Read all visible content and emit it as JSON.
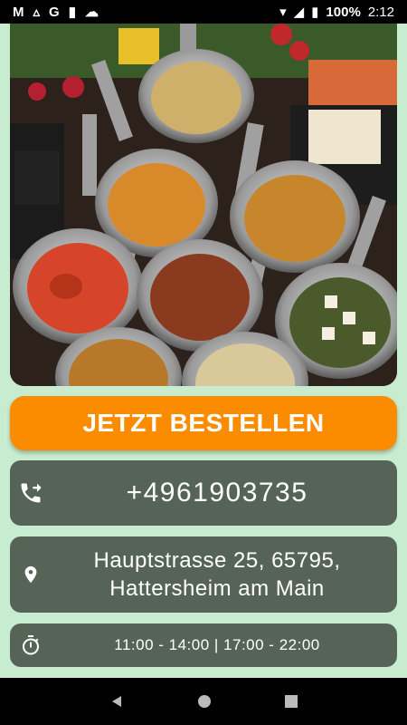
{
  "status_bar": {
    "app_icons": [
      "gmail-icon",
      "drive-icon",
      "google-icon",
      "sd-card-icon",
      "cloud-icon"
    ],
    "battery": "100%",
    "time": "2:12"
  },
  "hero": {
    "image": "indian-curry-dishes-photo"
  },
  "order_button": {
    "label": "JETZT BESTELLEN"
  },
  "contact": {
    "phone": "+4961903735",
    "address_line1": "Hauptstrasse 25, 65795,",
    "address_line2": "Hattersheim am Main",
    "hours": "11:00 - 14:00 | 17:00 - 22:00"
  },
  "colors": {
    "background": "#c8eccf",
    "accent": "#fb8c00",
    "card": "#566457"
  }
}
